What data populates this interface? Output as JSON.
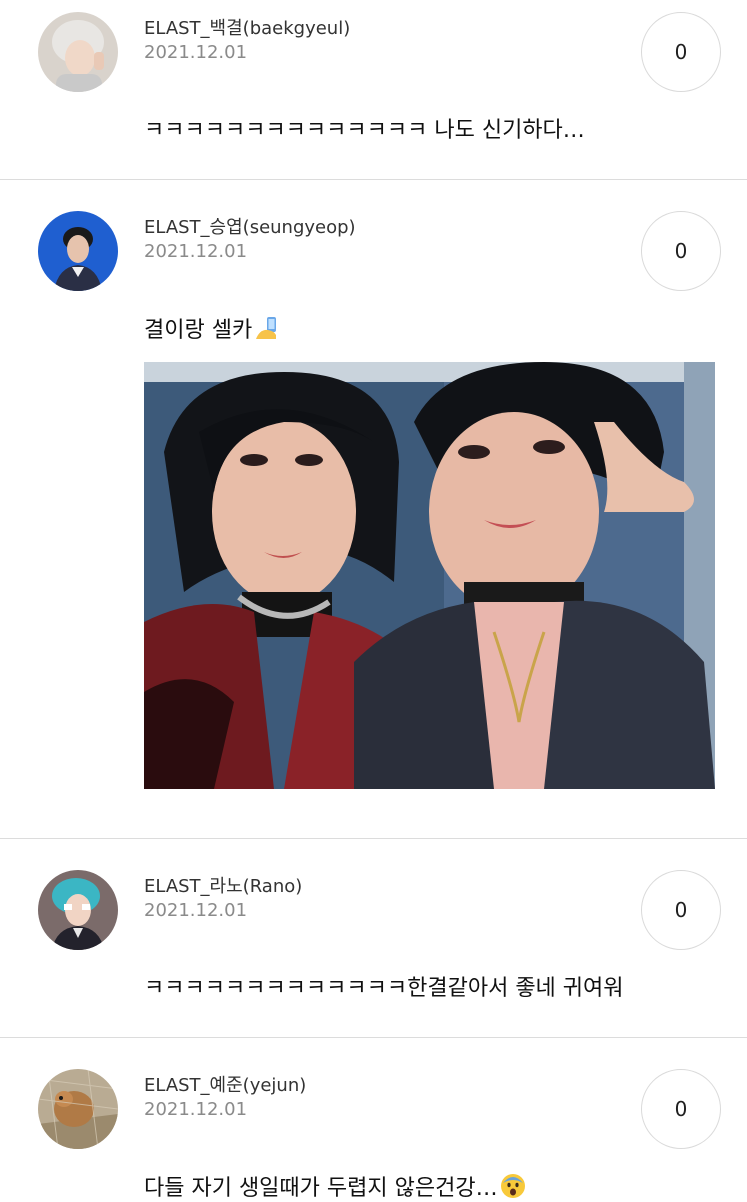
{
  "comments": [
    {
      "author": "ELAST_백결(baekgyeul)",
      "date": "2021.12.01",
      "likes": "0",
      "text": "ㅋㅋㅋㅋㅋㅋㅋㅋㅋㅋㅋㅋㅋㅋ 나도 신기하다…"
    },
    {
      "author": "ELAST_승엽(seungyeop)",
      "date": "2021.12.01",
      "likes": "0",
      "text": "결이랑 셀카",
      "text_emoji": "selfie-emoji"
    },
    {
      "author": "ELAST_라노(Rano)",
      "date": "2021.12.01",
      "likes": "0",
      "text": "ㅋㅋㅋㅋㅋㅋㅋㅋㅋㅋㅋㅋㅋ한결같아서 좋네 귀여워"
    },
    {
      "author": "ELAST_예준(yejun)",
      "date": "2021.12.01",
      "likes": "0",
      "text": "다들 자기 생일때가 두렵지 않은건강…",
      "text_emoji": "fearful-face-emoji"
    }
  ],
  "colors": {
    "divider": "#dcdcdc",
    "author": "#333333",
    "date": "#8a8a8a",
    "like_border": "#dadada"
  }
}
